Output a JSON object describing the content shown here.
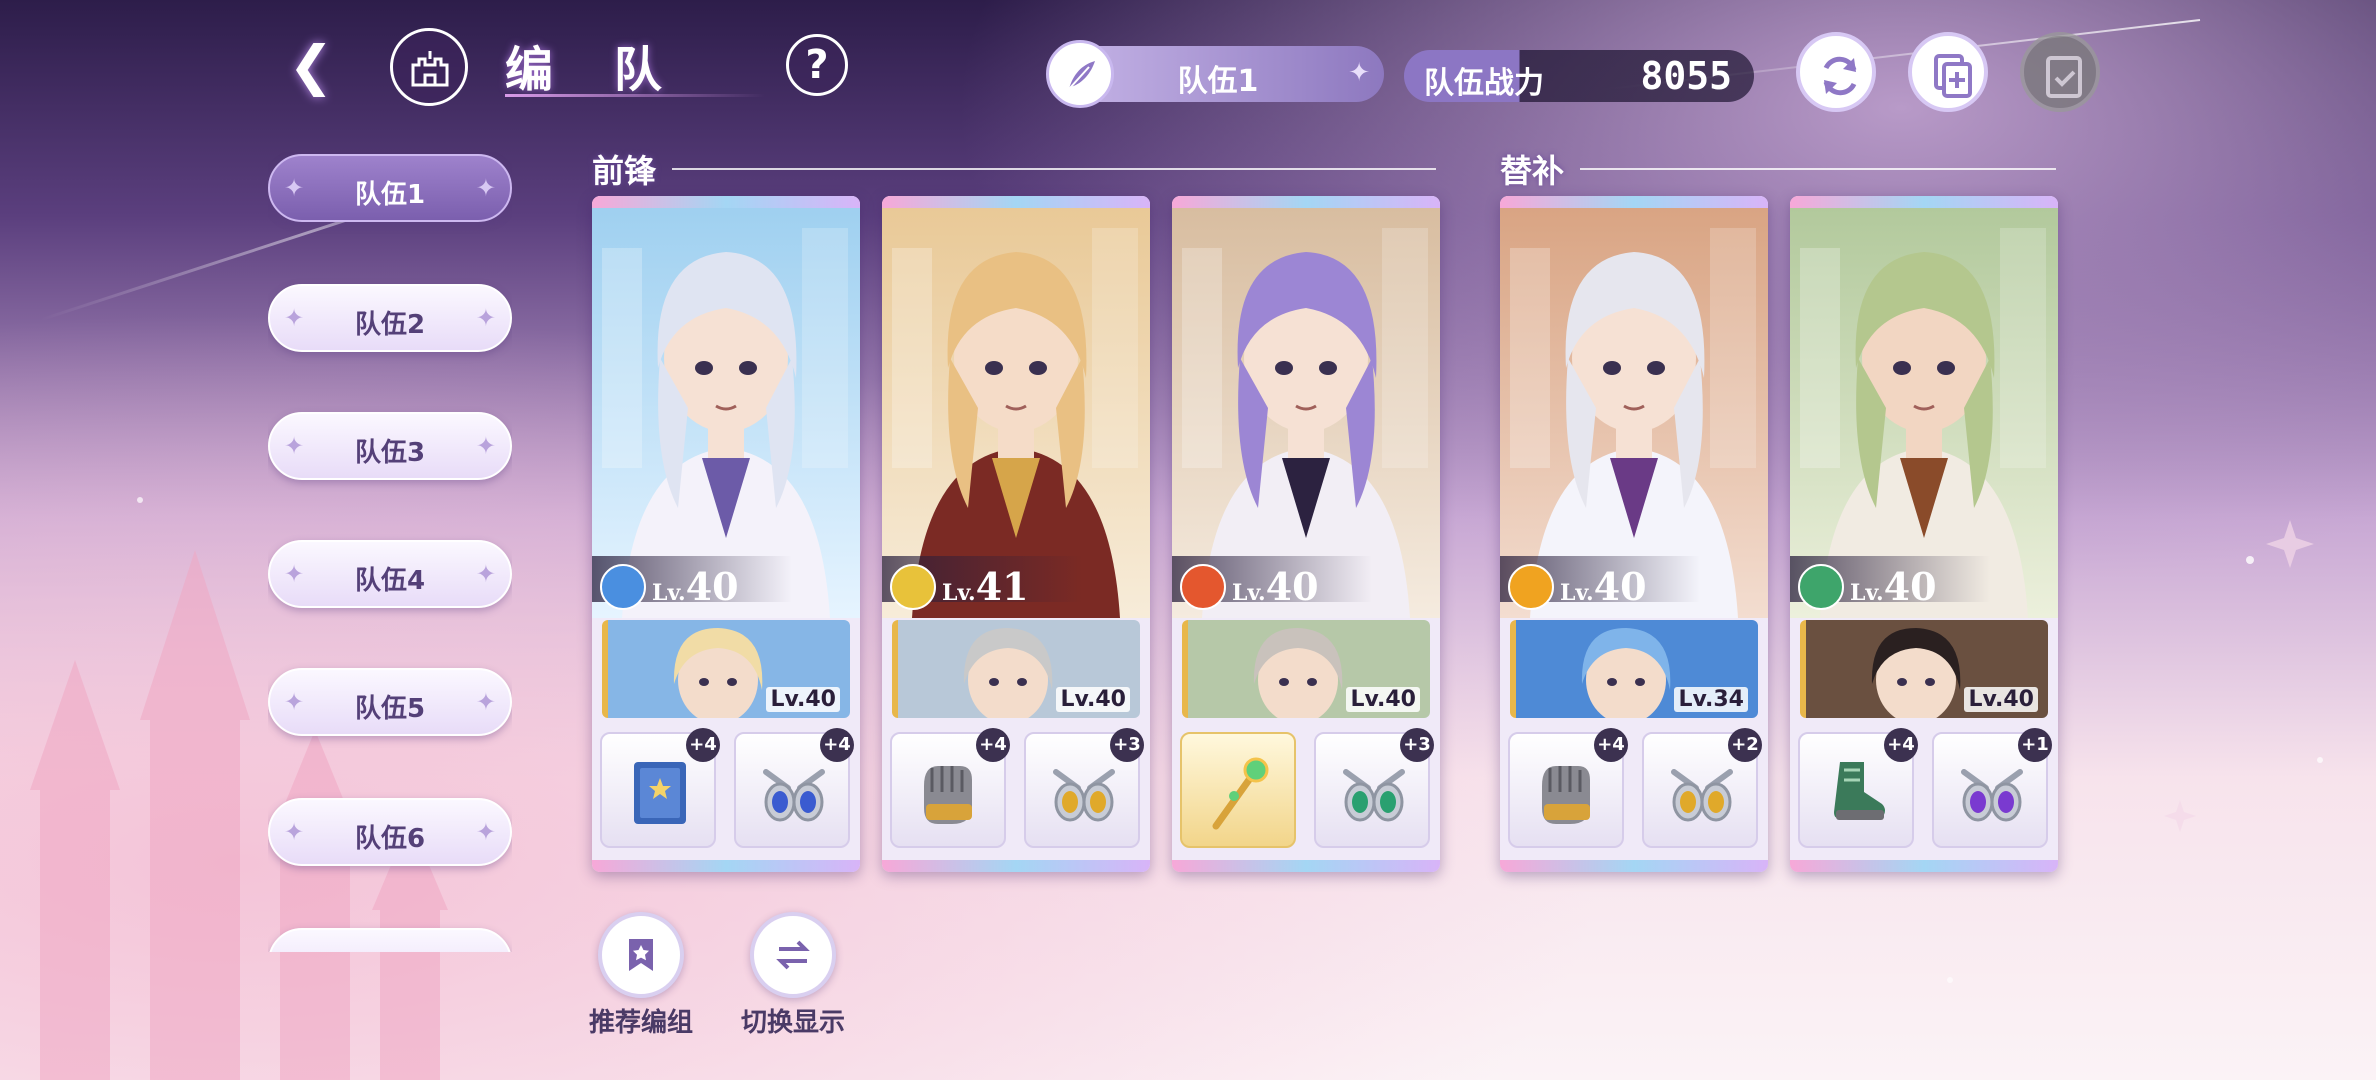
{
  "header": {
    "title": "编 队",
    "team_selector_label": "队伍1",
    "power_label": "队伍战力",
    "power_value": "8055"
  },
  "sidebar": {
    "items": [
      {
        "label": "队伍1",
        "active": true
      },
      {
        "label": "队伍2",
        "active": false
      },
      {
        "label": "队伍3",
        "active": false
      },
      {
        "label": "队伍4",
        "active": false
      },
      {
        "label": "队伍5",
        "active": false
      },
      {
        "label": "队伍6",
        "active": false
      }
    ]
  },
  "sections": {
    "front": "前锋",
    "bench": "替补"
  },
  "cards": [
    {
      "element": "water-icon",
      "element_color": "#4a8fe0",
      "lv_prefix": "Lv.",
      "level": "40",
      "support_level": "Lv.40",
      "equip": [
        {
          "icon": "book-icon",
          "plus": "+4"
        },
        {
          "icon": "blue-gem-ring-icon",
          "plus": "+4"
        }
      ]
    },
    {
      "element": "fist-icon",
      "element_color": "#e8c23a",
      "lv_prefix": "Lv.",
      "level": "41",
      "support_level": "Lv.40",
      "equip": [
        {
          "icon": "gauntlet-icon",
          "plus": "+4"
        },
        {
          "icon": "gold-gem-ring-icon",
          "plus": "+3"
        }
      ]
    },
    {
      "element": "fire-icon",
      "element_color": "#e4572e",
      "lv_prefix": "Lv.",
      "level": "40",
      "support_level": "Lv.40",
      "equip": [
        {
          "icon": "staff-icon",
          "plus": ""
        },
        {
          "icon": "green-gem-ring-icon",
          "plus": "+3"
        }
      ]
    },
    {
      "element": "fist-icon",
      "element_color": "#f0a320",
      "lv_prefix": "Lv.",
      "level": "40",
      "support_level": "Lv.34",
      "equip": [
        {
          "icon": "gauntlet-icon",
          "plus": "+4"
        },
        {
          "icon": "gold-gem-ring-icon",
          "plus": "+2"
        }
      ]
    },
    {
      "element": "wind-icon",
      "element_color": "#3ea56b",
      "lv_prefix": "Lv.",
      "level": "40",
      "support_level": "Lv.40",
      "equip": [
        {
          "icon": "boot-icon",
          "plus": "+4"
        },
        {
          "icon": "purple-gem-ring-icon",
          "plus": "+1"
        }
      ]
    }
  ],
  "actions": {
    "recommend": "推荐编组",
    "switch_display": "切换显示"
  }
}
